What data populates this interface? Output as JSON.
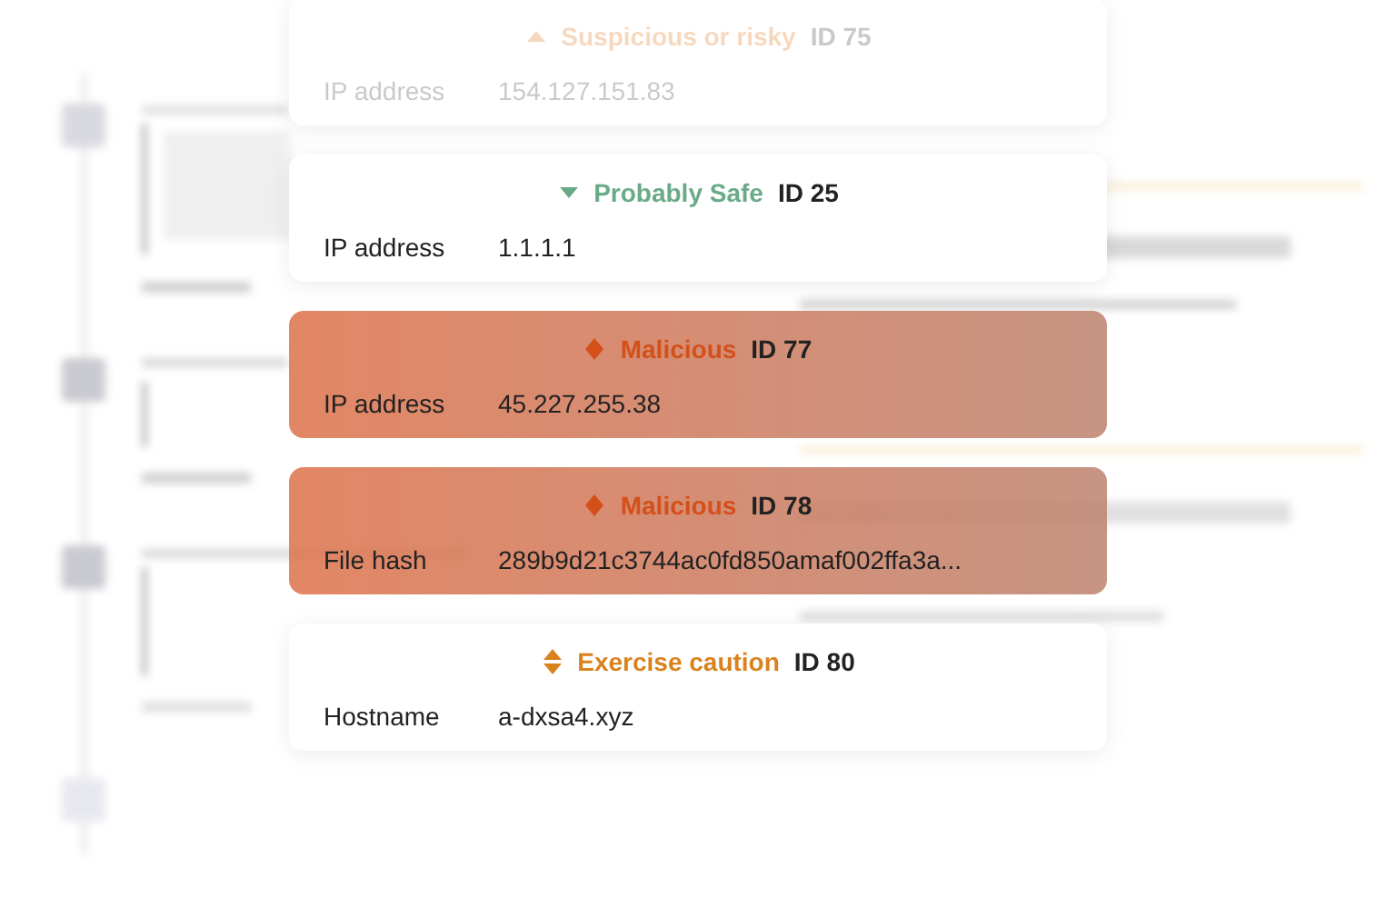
{
  "cards": [
    {
      "kind": "suspicious",
      "faded": true,
      "verdict": "Suspicious or risky",
      "id": "ID 75",
      "field": "IP address",
      "value": "154.127.151.83"
    },
    {
      "kind": "safe",
      "faded": false,
      "verdict": "Probably Safe",
      "id": "ID 25",
      "field": "IP address",
      "value": "1.1.1.1"
    },
    {
      "kind": "malicious",
      "faded": false,
      "verdict": "Malicious",
      "id": "ID 77",
      "field": "IP address",
      "value": "45.227.255.38"
    },
    {
      "kind": "malicious",
      "faded": false,
      "verdict": "Malicious",
      "id": "ID 78",
      "field": "File hash",
      "value": "289b9d21c3744ac0fd850amaf002ffa3a..."
    },
    {
      "kind": "caution",
      "faded": false,
      "verdict": "Exercise caution",
      "id": "ID 80",
      "field": "Hostname",
      "value": "a-dxsa4.xyz"
    }
  ]
}
